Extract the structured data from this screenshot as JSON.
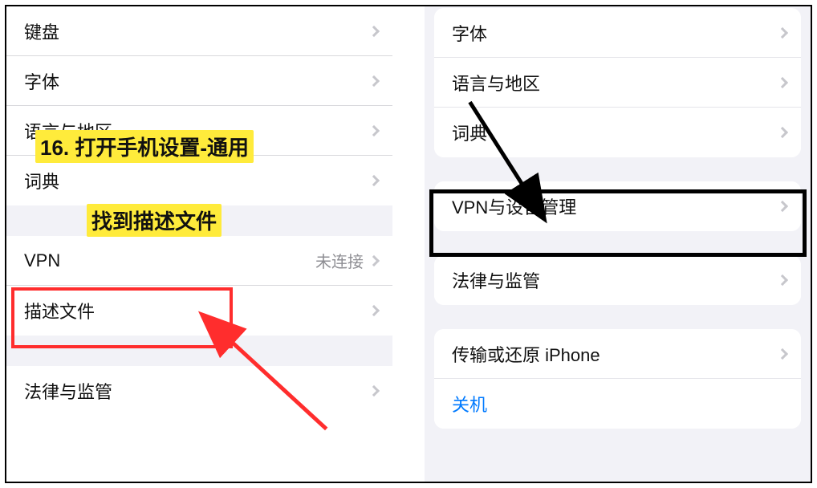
{
  "left": {
    "items": [
      {
        "label": "键盘"
      },
      {
        "label": "字体"
      },
      {
        "label": "语言与地区"
      },
      {
        "label": "词典"
      }
    ],
    "vpn": {
      "label": "VPN",
      "detail": "未连接"
    },
    "profile": {
      "label": "描述文件"
    },
    "legal": {
      "label": "法律与监管"
    }
  },
  "right": {
    "group1": [
      {
        "label": "字体"
      },
      {
        "label": "语言与地区"
      },
      {
        "label": "词典"
      }
    ],
    "vpn": {
      "label": "VPN与设备管理"
    },
    "legal": {
      "label": "法律与监管"
    },
    "transfer": {
      "label": "传输或还原 iPhone"
    },
    "shutdown": {
      "label": "关机"
    }
  },
  "annotation": {
    "line1": "16. 打开手机设置-通用",
    "line2": "找到描述文件"
  }
}
